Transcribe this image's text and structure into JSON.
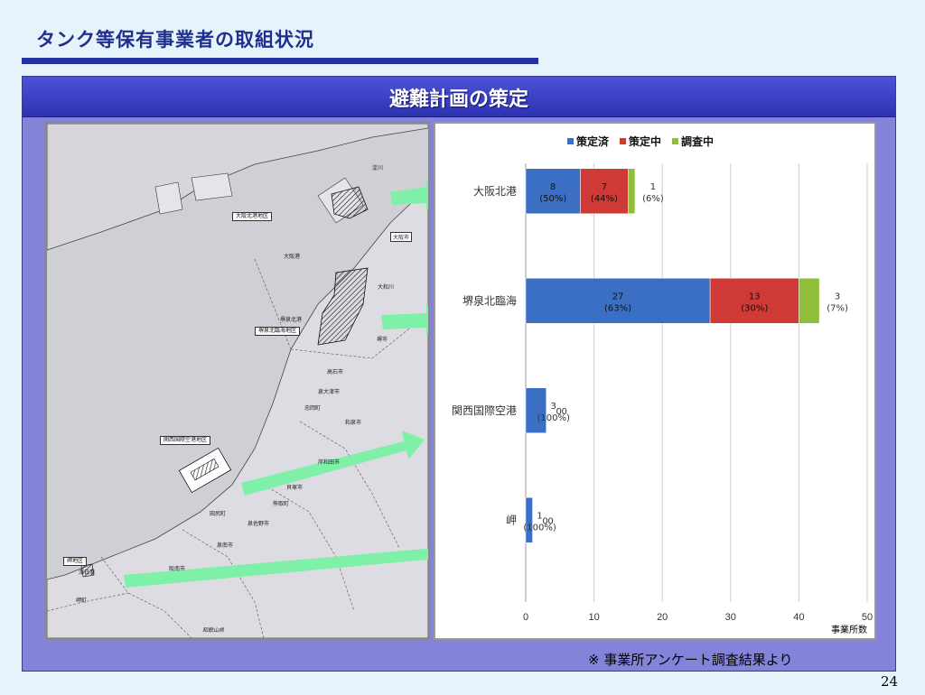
{
  "page": {
    "title": "タンク等保有事業者の取組状況",
    "header": "避難計画の策定",
    "note": "※ 事業所アンケート調査結果より",
    "page_number": "24"
  },
  "map": {
    "district_labels": [
      "大阪北港地区",
      "堺泉北臨海地区",
      "関西国際空港地区",
      "岬地区"
    ],
    "place_labels": [
      "淀川",
      "大阪港",
      "大阪市",
      "大和川",
      "堺泉北港",
      "堺市",
      "高石市",
      "泉大津市",
      "忠岡町",
      "和泉市",
      "岸和田市",
      "貝塚市",
      "熊取町",
      "泉佐野市",
      "田尻町",
      "泉南市",
      "阪南市",
      "深日港",
      "岬町",
      "和歌山県"
    ]
  },
  "chart_data": {
    "type": "bar",
    "orientation": "horizontal",
    "stacked": true,
    "categories": [
      "大阪北港",
      "堺泉北臨海",
      "関西国際空港",
      "岬"
    ],
    "series": [
      {
        "name": "策定済",
        "color": "#3b6fc4",
        "values": [
          8,
          27,
          3,
          1
        ],
        "labels": [
          "8\n(50%)",
          "27\n(63%)",
          "3\n(100%)",
          "1\n(100%)"
        ]
      },
      {
        "name": "策定中",
        "color": "#cf3a36",
        "values": [
          7,
          13,
          0,
          0
        ],
        "labels": [
          "7\n(44%)",
          "13\n(30%)",
          "0",
          "0"
        ]
      },
      {
        "name": "調査中",
        "color": "#8fbe3b",
        "values": [
          1,
          3,
          0,
          0
        ],
        "labels": [
          "1\n(6%)",
          "3\n(7%)",
          "0",
          "0"
        ]
      }
    ],
    "xlim": [
      0,
      50
    ],
    "xticks": [
      0,
      10,
      20,
      30,
      40,
      50
    ],
    "xlabel": "事業所数",
    "legend_position": "top",
    "grid": true
  }
}
